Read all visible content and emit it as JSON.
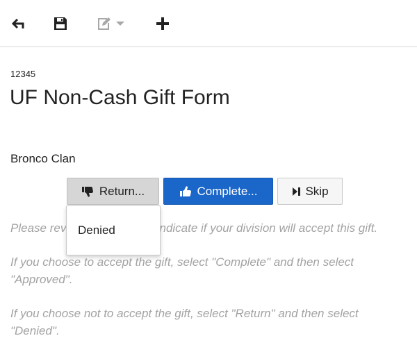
{
  "toolbar": {
    "back_icon": "back-arrow-icon",
    "save_icon": "save-icon",
    "edit_icon": "edit-icon",
    "add_icon": "plus-icon"
  },
  "form": {
    "id": "12345",
    "title": "UF Non-Cash Gift Form",
    "organization": "Bronco Clan"
  },
  "actions": {
    "return_label": "Return...",
    "complete_label": "Complete...",
    "skip_label": "Skip"
  },
  "dropdown": {
    "items": [
      "Denied"
    ]
  },
  "instructions": [
    "Please review the form and indicate if your division will accept this gift.",
    "If you choose to accept the gift, select \"Complete\" and then select \"Approved\".",
    "If you choose not to accept the gift, select \"Return\" and then select \"Denied\"."
  ],
  "colors": {
    "primary": "#1b66c9",
    "muted_text": "#a2a2a2",
    "return_bg": "#d6d6d6"
  }
}
